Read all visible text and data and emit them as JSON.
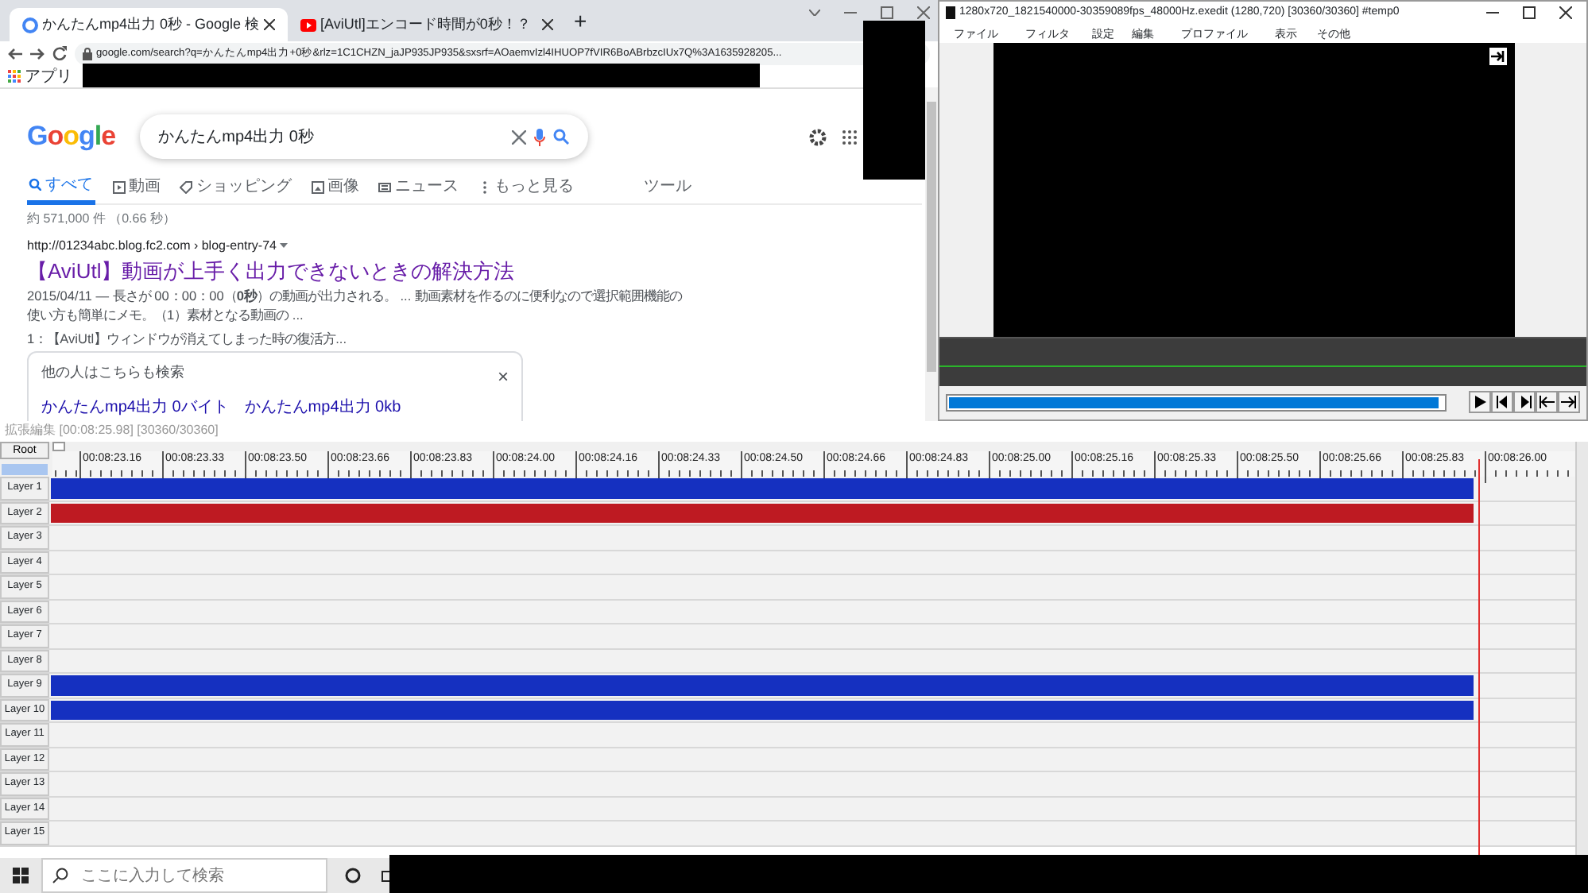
{
  "browser": {
    "tabs": [
      {
        "title": "かんたんmp4出力 0秒 - Google 検",
        "kind": "google",
        "selected": true
      },
      {
        "title": "[AviUtl]エンコード時間が0秒！？",
        "kind": "video",
        "selected": false
      }
    ],
    "new_tab": "+",
    "address": "google.com/search?q=かんたんmp4出力+0秒&rlz=1C1CHZN_jaJP935JP935&sxsrf=AOaemvIzl4IHUOP7fVIR6BoABrbzcIUx7Q%3A1635928205...",
    "bookmarks": [
      "アプリ"
    ],
    "logo": "Google",
    "query": "かんたんmp4出力 0秒",
    "nav": [
      {
        "label": "すべて",
        "kind": "search",
        "selected": true
      },
      {
        "label": "動画",
        "kind": "video",
        "selected": false
      },
      {
        "label": "ショッピング",
        "kind": "tag",
        "selected": false
      },
      {
        "label": "画像",
        "kind": "image",
        "selected": false
      },
      {
        "label": "ニュース",
        "kind": "news",
        "selected": false
      },
      {
        "label": "もっと見る",
        "kind": "more",
        "selected": false
      },
      {
        "label": "ツール",
        "kind": "plain",
        "selected": false
      }
    ],
    "stats": "約 571,000 件 （0.66 秒）",
    "result": {
      "url": "http://01234abc.blog.fc2.com › blog-entry-74",
      "title": "【AviUtl】動画が上手く出力できないときの解決方法",
      "snippet": "2015/04/11 — 長さが 00：00：00（**0秒**）の動画が出力される。 ... 動画素材を作るのに便利なので選択範囲機能の使い方も簡単にメモ。（1）素材となる動画の ...",
      "sitelink": "1：【AviUtl】ウィンドウが消えてしまった時の復活方..."
    },
    "related": {
      "title": "他の人はこちらも検索",
      "close": "×",
      "links": [
        "かんたんmp4出力 0バイト",
        "かんたんmp4出力 0kb"
      ]
    }
  },
  "aviutl": {
    "title": "1280x720_1821540000-30359089fps_48000Hz.exedit (1280,720)  [30360/30360]  #temp0",
    "menu": [
      "ファイル",
      "フィルタ",
      "設定",
      "編集",
      "プロファイル",
      "表示",
      "その他"
    ],
    "seek": {
      "level": 0.99
    }
  },
  "timeline": {
    "title": "拡張編集 [00:08:25.98] [30360/30360]",
    "root": "Root",
    "ticks": [
      "00:08:23.16",
      "00:08:23.33",
      "00:08:23.50",
      "00:08:23.66",
      "00:08:23.83",
      "00:08:24.00",
      "00:08:24.16",
      "00:08:24.33",
      "00:08:24.50",
      "00:08:24.66",
      "00:08:24.83",
      "00:08:25.00",
      "00:08:25.16",
      "00:08:25.33",
      "00:08:25.50",
      "00:08:25.66",
      "00:08:25.83",
      "00:08:26.00"
    ],
    "layers": [
      {
        "name": "Layer 1",
        "color": "#1530c0"
      },
      {
        "name": "Layer 2",
        "color": "#be1a22"
      },
      {
        "name": "Layer 3"
      },
      {
        "name": "Layer 4"
      },
      {
        "name": "Layer 5"
      },
      {
        "name": "Layer 6"
      },
      {
        "name": "Layer 7"
      },
      {
        "name": "Layer 8"
      },
      {
        "name": "Layer 9",
        "color": "#1530c0"
      },
      {
        "name": "Layer 10",
        "color": "#1530c0"
      },
      {
        "name": "Layer 11"
      },
      {
        "name": "Layer 12"
      },
      {
        "name": "Layer 13"
      },
      {
        "name": "Layer 14"
      },
      {
        "name": "Layer 15"
      }
    ]
  },
  "zoom": {
    "level": 1
  },
  "taskbar": {
    "search_placeholder": "ここに入力して検索"
  }
}
